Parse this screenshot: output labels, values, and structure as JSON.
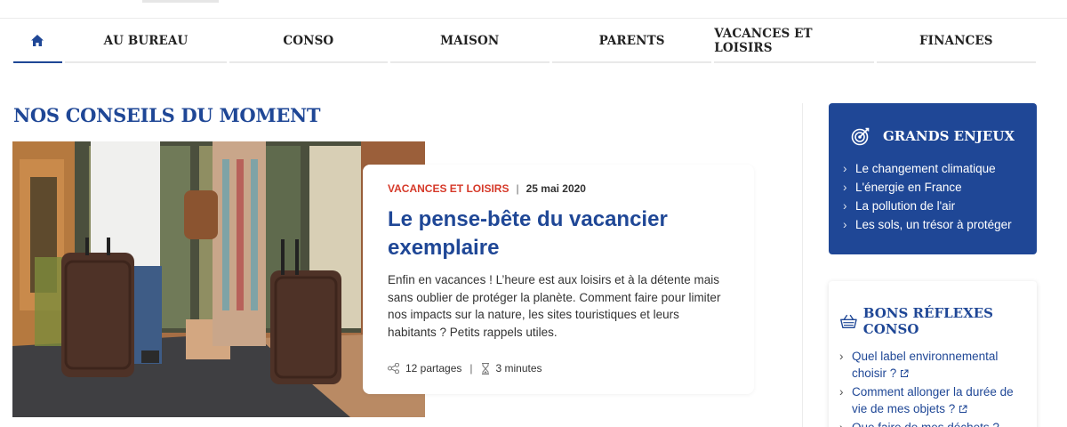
{
  "nav": {
    "home_icon": "home-icon",
    "items": [
      "AU BUREAU",
      "CONSO",
      "MAISON",
      "PARENTS",
      "VACANCES ET LOISIRS",
      "FINANCES"
    ],
    "active": "home"
  },
  "section_title": "NOS CONSEILS DU MOMENT",
  "article": {
    "category": "VACANCES ET LOISIRS",
    "date": "25 mai 2020",
    "title": "Le pense-bête du vacancier exemplaire",
    "excerpt": "Enfin en vacances ! L’heure est aux loisirs et à la détente mais sans oublier de protéger la planète. Comment faire pour limiter nos impacts sur la nature, les sites touristiques et leurs habitants ? Petits rappels utiles.",
    "shares": "12 partages",
    "reading_time": "3 minutes"
  },
  "grands_enjeux": {
    "title": "GRANDS ENJEUX",
    "icon": "target-icon",
    "links": [
      "Le changement climatique",
      "L'énergie en France",
      "La pollution de l'air",
      "Les sols, un trésor à protéger"
    ]
  },
  "bons_reflexes": {
    "title": "BONS RÉFLEXES CONSO",
    "icon": "basket-icon",
    "links": [
      "Quel label environnemental choisir ?",
      "Comment allonger la durée de vie de mes objets ?",
      "Que faire de mes déchets ?"
    ]
  },
  "colors": {
    "brand_blue": "#1f4796",
    "category_red": "#d63a2a"
  }
}
